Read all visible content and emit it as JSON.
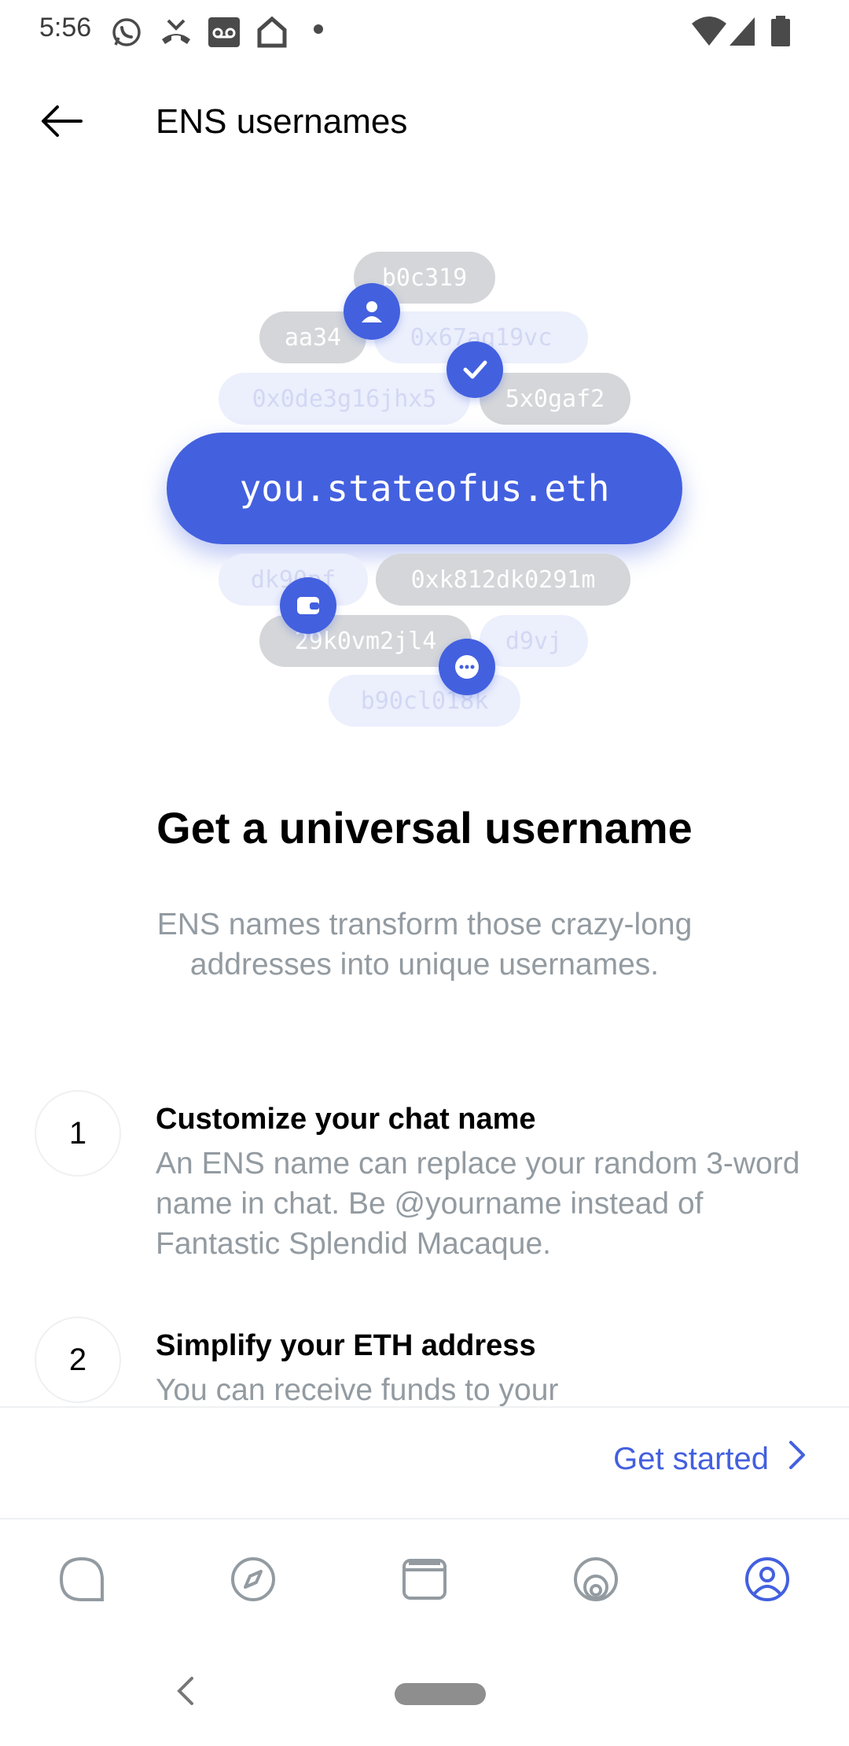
{
  "status_bar": {
    "time": "5:56",
    "icons": [
      "whatsapp-icon",
      "missed-call-icon",
      "voicemail-icon",
      "home-icon",
      "dot-icon",
      "wifi-icon",
      "signal-icon",
      "battery-icon"
    ]
  },
  "header": {
    "title": "ENS usernames",
    "back_icon": "arrow-left-icon"
  },
  "hero": {
    "main_name": "you.stateofus.eth",
    "chips": [
      "b0c319",
      "aa34",
      "0x67aq19vc",
      "0x0de3g16jhx5",
      "5x0gaf2",
      "dk90pf",
      "0xk812dk0291m",
      "29k0vm2jl4",
      "d9vj",
      "b90cl018k"
    ],
    "badges": [
      "user-icon",
      "checkmark-icon",
      "wallet-icon",
      "chat-bubble-icon"
    ]
  },
  "intro": {
    "title": "Get a universal username",
    "subtitle": "ENS names transform those crazy-long addresses into unique usernames."
  },
  "steps": [
    {
      "number": "1",
      "title": "Customize your chat name",
      "description": "An ENS name can replace your random 3-word name in chat. Be @yourname instead of Fantastic Splendid Macaque."
    },
    {
      "number": "2",
      "title": "Simplify your ETH address",
      "description": "You can receive funds to your"
    }
  ],
  "action": {
    "label": "Get started",
    "icon": "chevron-right-icon"
  },
  "tabs": [
    {
      "name": "chat",
      "icon": "chat-icon",
      "active": false
    },
    {
      "name": "browser",
      "icon": "compass-icon",
      "active": false
    },
    {
      "name": "wallet",
      "icon": "wallet-icon",
      "active": false
    },
    {
      "name": "status",
      "icon": "status-icon",
      "active": false
    },
    {
      "name": "profile",
      "icon": "profile-icon",
      "active": true
    }
  ],
  "colors": {
    "accent": "#4360df",
    "muted_text": "#939ba1",
    "chip_gray": "#d4d6d9",
    "chip_light": "#eceffc",
    "tab_inactive": "#939ba1"
  }
}
